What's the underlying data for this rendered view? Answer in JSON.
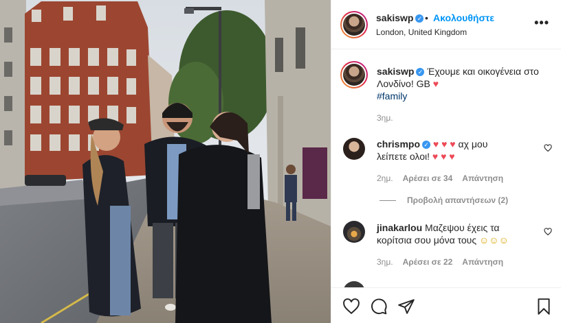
{
  "post": {
    "author": "sakiswp",
    "follow_label": "Ακολουθήστε",
    "dot": "•",
    "location": "London, United Kingdom",
    "more_label": "•••"
  },
  "caption": {
    "username": "sakiswp",
    "text_line1": "Έχουμε και οικογένεια στο",
    "text_line2": "Λονδίνο! GB",
    "hashtag": "#family",
    "time": "3ημ."
  },
  "comments": [
    {
      "username": "chrismpo",
      "text_line1": "αχ μου",
      "text_line2": "λείπετε ολοι!",
      "time": "2ημ.",
      "likes": "Αρέσει σε 34",
      "reply": "Απάντηση"
    },
    {
      "username": "jinakarlou",
      "text_line1": "Μαζεψου έχεις τα",
      "text_line2": "κορίτσια σου μόνα τους",
      "time": "3ημ.",
      "likes": "Αρέσει σε 22",
      "reply": "Απάντηση"
    }
  ],
  "view_replies": "Προβολή απαντήσεων (2)",
  "colors": {
    "accent": "#0095f6",
    "verified": "#3897f0",
    "heart": "#ed4956",
    "muted": "#8e8e8e"
  },
  "icons": [
    "verified-icon",
    "more-icon",
    "heart-icon",
    "like-icon",
    "comment-icon",
    "share-icon",
    "save-icon"
  ]
}
